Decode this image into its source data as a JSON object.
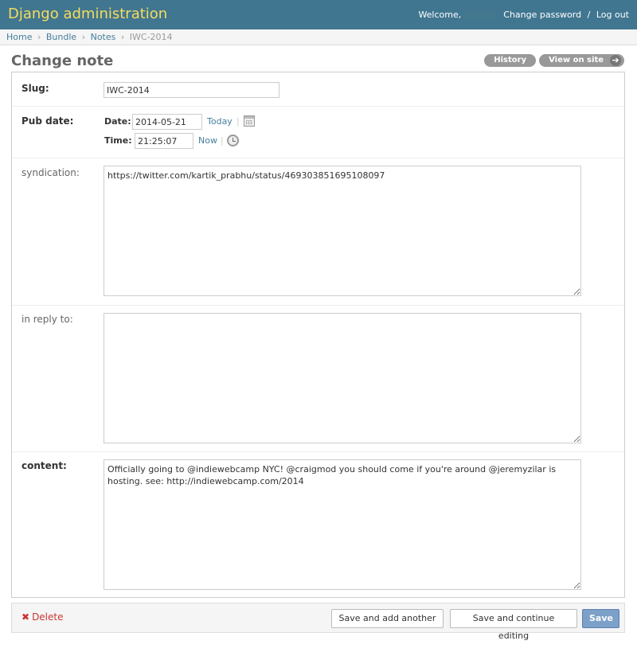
{
  "header": {
    "brand": "Django administration",
    "welcome": "Welcome,",
    "change_password": "Change password",
    "separator": "/",
    "logout": "Log out"
  },
  "breadcrumbs": {
    "home": "Home",
    "app": "Bundle",
    "model": "Notes",
    "current": "IWC-2014",
    "chevron": "›"
  },
  "page": {
    "title": "Change note",
    "history": "History",
    "view_on_site": "View on site",
    "view_on_site_arrow": "➔"
  },
  "form": {
    "slug": {
      "label": "Slug:",
      "value": "IWC-2014"
    },
    "pub_date": {
      "label": "Pub date:",
      "date_label": "Date:",
      "date_value": "2014-05-21",
      "today": "Today",
      "time_label": "Time:",
      "time_value": "21:25:07",
      "now": "Now",
      "pipe": "|"
    },
    "syndication": {
      "label": "syndication:",
      "value": "https://twitter.com/kartik_prabhu/status/469303851695108097"
    },
    "in_reply_to": {
      "label": "in reply to:",
      "value": ""
    },
    "content": {
      "label": "content:",
      "value": "Officially going to @indiewebcamp NYC! @craigmod you should come if you're around @jeremyzilar is hosting. see: http://indiewebcamp.com/2014"
    }
  },
  "submit_row": {
    "delete_icon": "✖",
    "delete": "Delete",
    "save_add_another": "Save and add another",
    "save_continue": "Save and continue editing",
    "save": "Save"
  },
  "colors": {
    "header_bg": "#417690",
    "brand": "#f5dd5d",
    "link": "#447e9b",
    "delete": "#cc3434",
    "save_button": "#7ca0c7"
  }
}
